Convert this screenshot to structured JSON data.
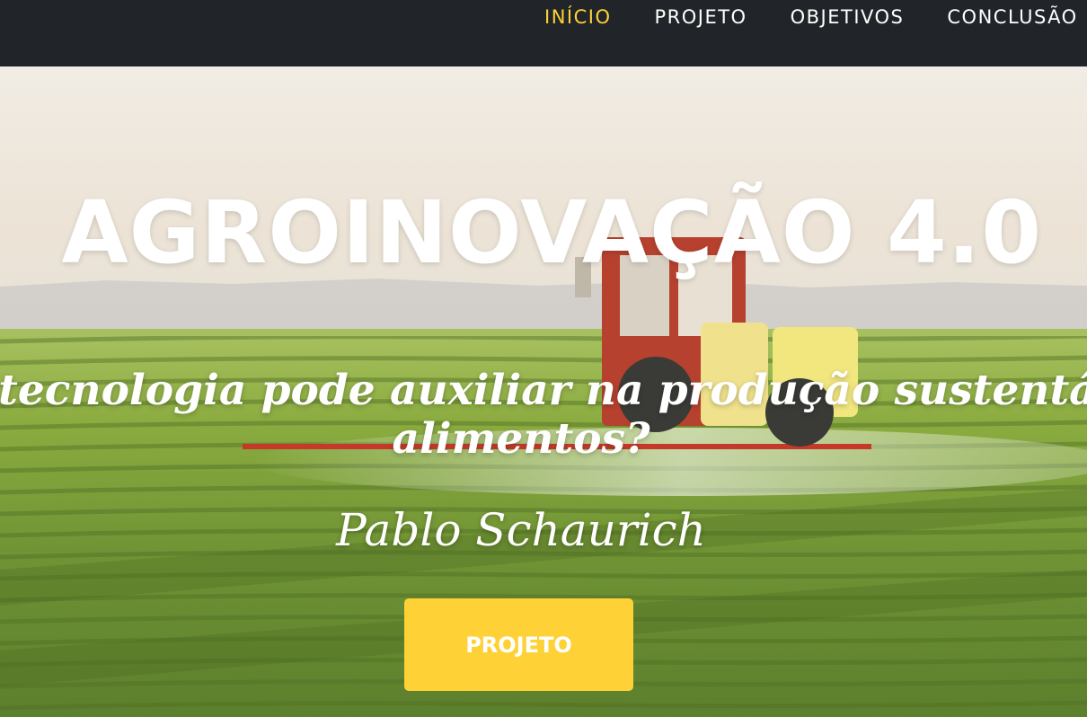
{
  "nav": {
    "items": [
      {
        "label": "INÍCIO",
        "active": true
      },
      {
        "label": "PROJETO",
        "active": false
      },
      {
        "label": "OBJETIVOS",
        "active": false
      },
      {
        "label": "CONCLUSÃO",
        "active": false
      }
    ]
  },
  "hero": {
    "title": "AGROINOVAÇÃO 4.0",
    "subtitle_line1": "Como a tecnologia pode auxiliar na produção sustentável de",
    "subtitle_line2": "alimentos?",
    "author": "Pablo Schaurich",
    "button_label": "PROJETO"
  },
  "colors": {
    "navbar_bg": "#212529",
    "accent": "#fed136",
    "text": "#ffffff"
  }
}
